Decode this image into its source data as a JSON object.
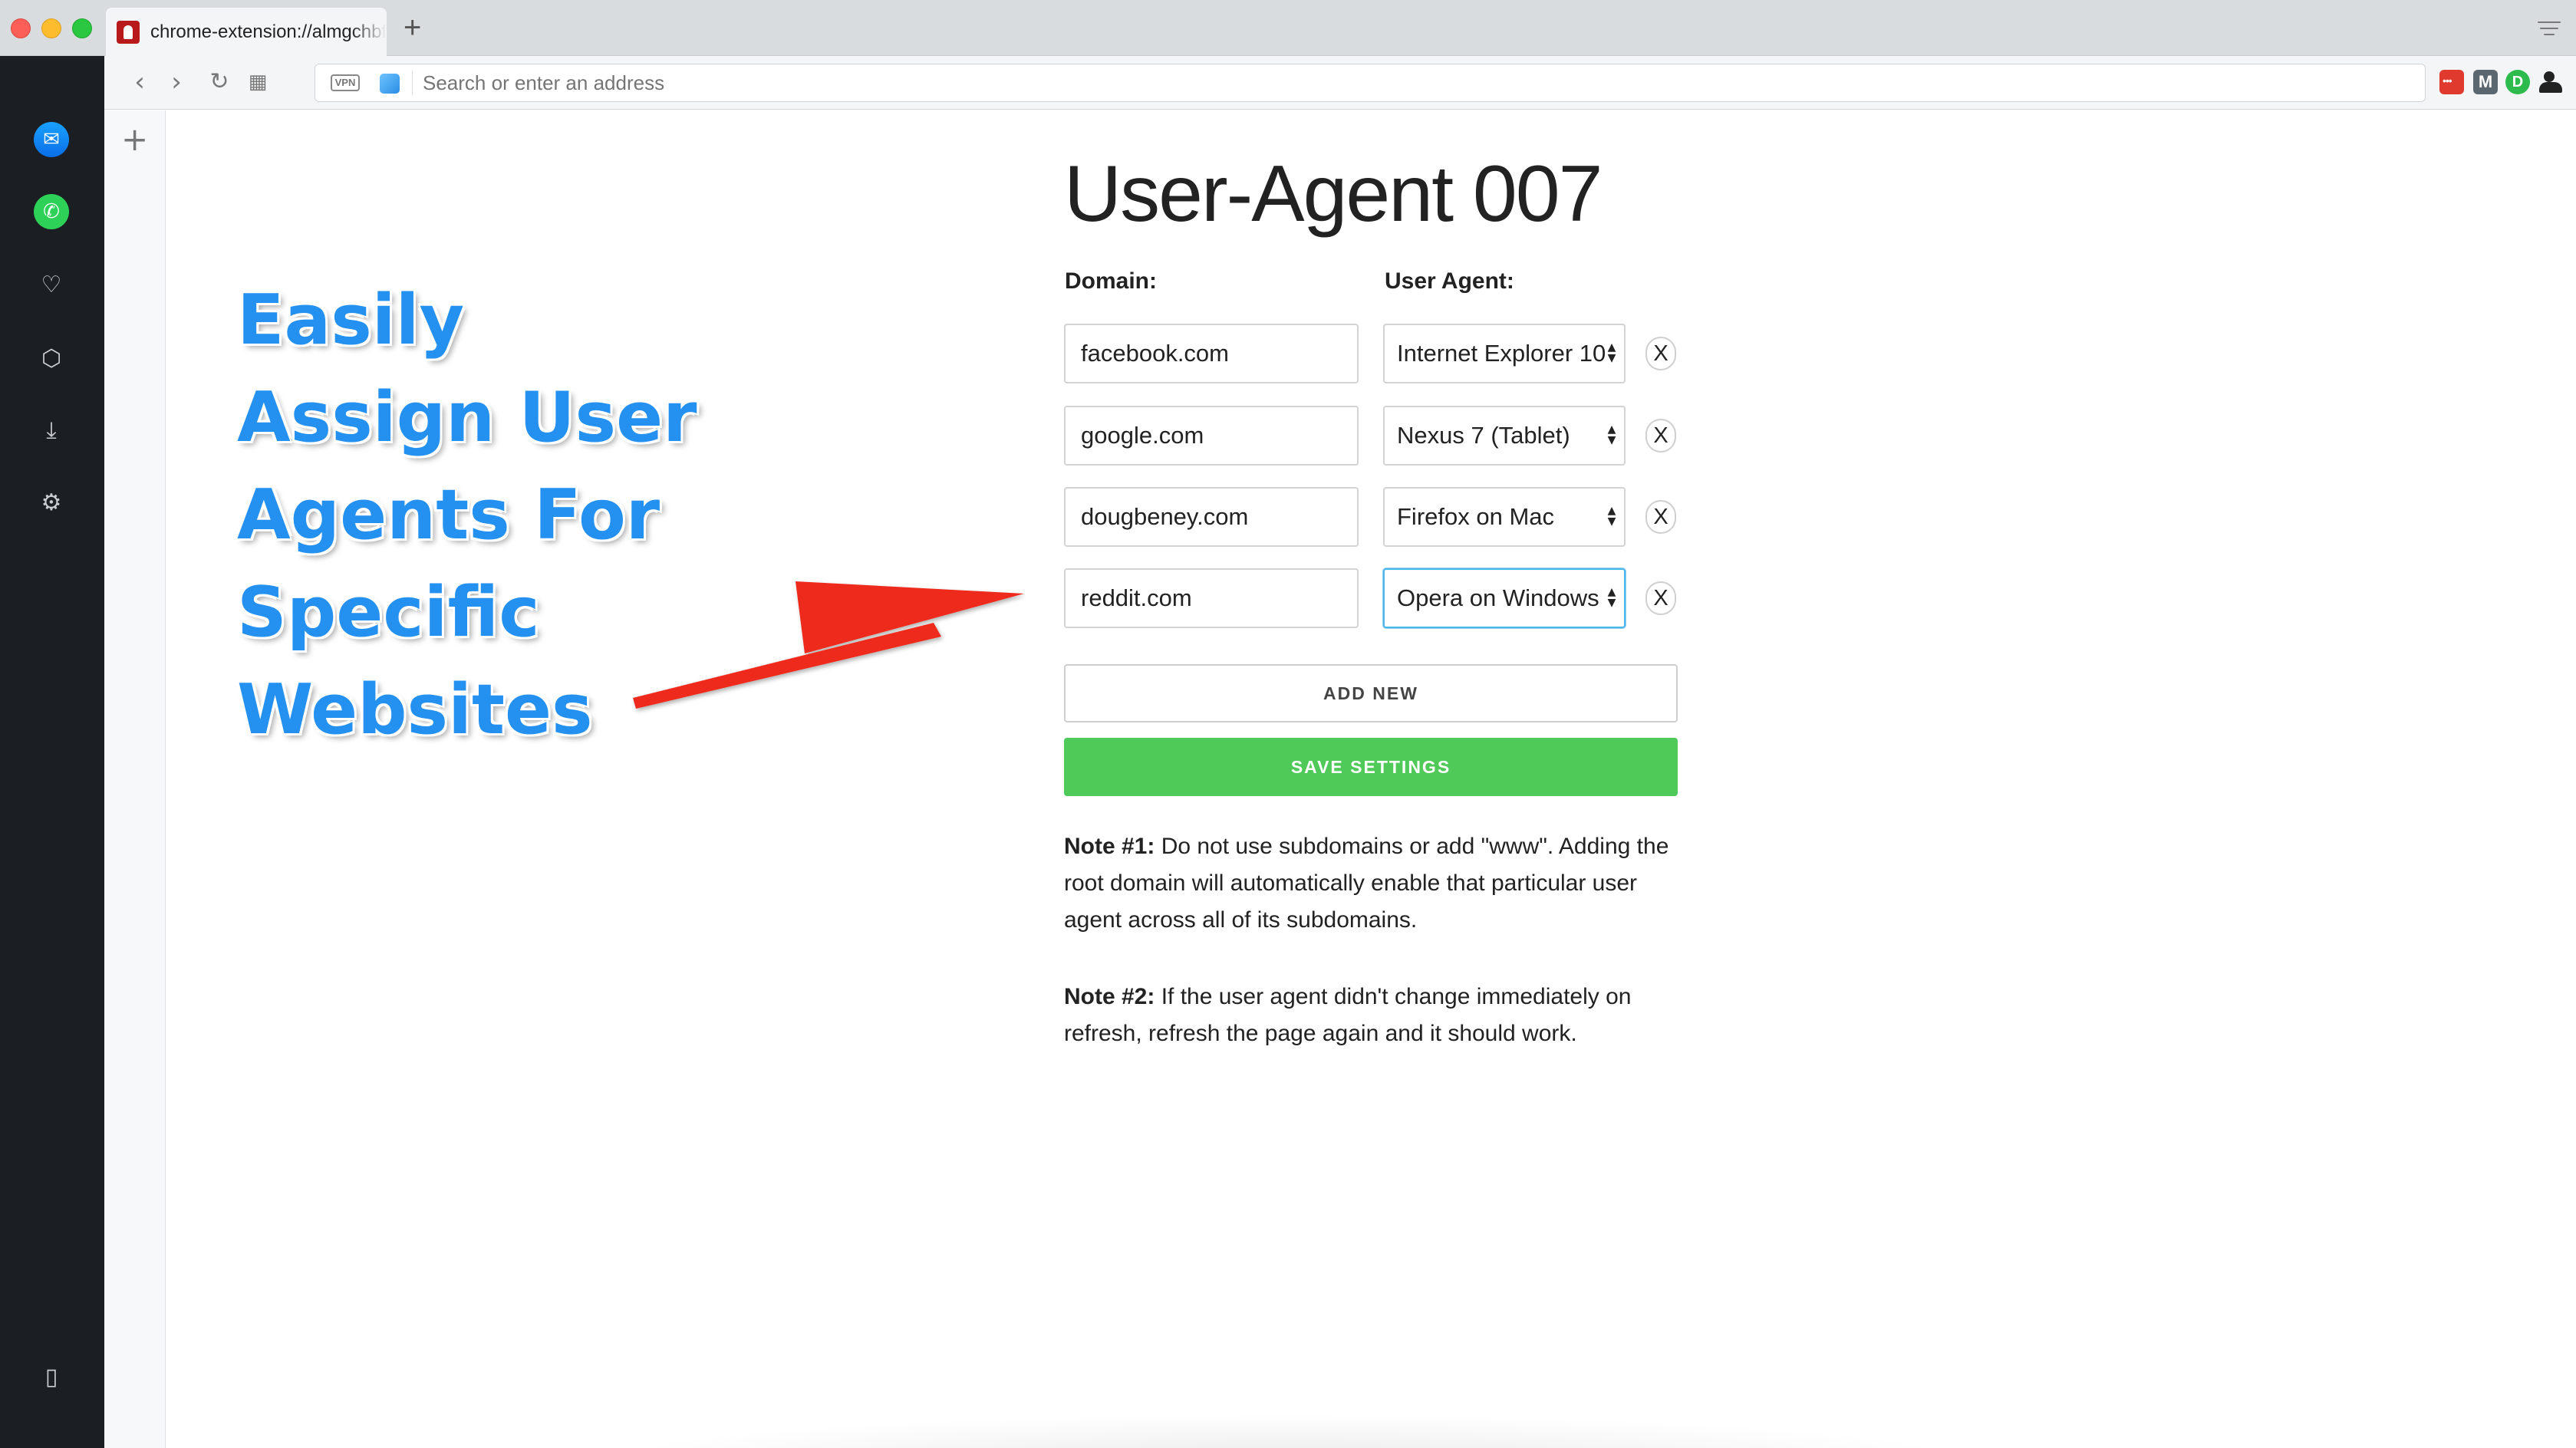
{
  "browser": {
    "tab_title": "chrome-extension://almgchbfodkhdbjhmhkijeoheaglnfgm",
    "new_tab_symbol": "+",
    "address_placeholder": "Search or enter an address",
    "vpn_label": "VPN",
    "ext_two_label": "M",
    "ext_three_label": "D"
  },
  "sidebar": {
    "items": [
      {
        "name": "messenger-icon",
        "glyph": "✆"
      },
      {
        "name": "whatsapp-icon",
        "glyph": "✆"
      },
      {
        "name": "heart-icon",
        "glyph": "♡"
      },
      {
        "name": "cube-icon",
        "glyph": "⬡"
      },
      {
        "name": "download-icon",
        "glyph": "⤓"
      },
      {
        "name": "settings-icon",
        "glyph": "⚙"
      }
    ]
  },
  "promo": {
    "line1": "Easily",
    "line2": "Assign User",
    "line3": "Agents For",
    "line4": "Specific",
    "line5": "Websites",
    "color": "#2490f0",
    "arrow_color": "#ee2a1b"
  },
  "extension": {
    "title": "User-Agent 007",
    "domain_label": "Domain:",
    "agent_label": "User Agent:",
    "rows": [
      {
        "domain": "facebook.com",
        "agent": "Internet Explorer 10",
        "remove": "X"
      },
      {
        "domain": "google.com",
        "agent": "Nexus 7 (Tablet)",
        "remove": "X"
      },
      {
        "domain": "dougbeney.com",
        "agent": "Firefox on Mac",
        "remove": "X"
      },
      {
        "domain": "reddit.com",
        "agent": "Opera on Windows",
        "remove": "X"
      }
    ],
    "add_new": "ADD NEW",
    "save_settings": "SAVE SETTINGS",
    "save_color": "#4fc958",
    "note1_label": "Note #1:",
    "note1_text": " Do not use subdomains or add \"www\". Adding the root domain will automatically enable that particular user agent across all of its subdomains.",
    "note2_label": "Note #2:",
    "note2_text": " If the user agent didn't change immediately on refresh, refresh the page again and it should work."
  }
}
